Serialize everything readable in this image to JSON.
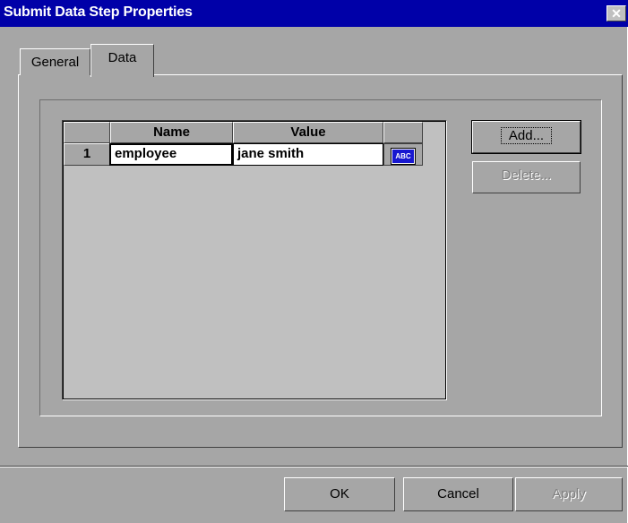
{
  "window": {
    "title": "Submit Data Step Properties",
    "close_glyph": "✕"
  },
  "tabs": [
    {
      "label": "General",
      "active": false
    },
    {
      "label": "Data",
      "active": true
    }
  ],
  "grid": {
    "columns": [
      "",
      "Name",
      "Value",
      ""
    ],
    "rows": [
      {
        "index": "1",
        "name": "employee",
        "value": "jane smith",
        "type_icon": "abc-icon",
        "type_text": "ABC"
      }
    ]
  },
  "side_buttons": {
    "add_label": "Add...",
    "delete_label": "Delete..."
  },
  "footer_buttons": {
    "ok_label": "OK",
    "cancel_label": "Cancel",
    "apply_label": "Apply"
  },
  "colors": {
    "titlebar": "#0000a8",
    "face": "#a6a6a6",
    "icon_blue": "#1818d0"
  }
}
